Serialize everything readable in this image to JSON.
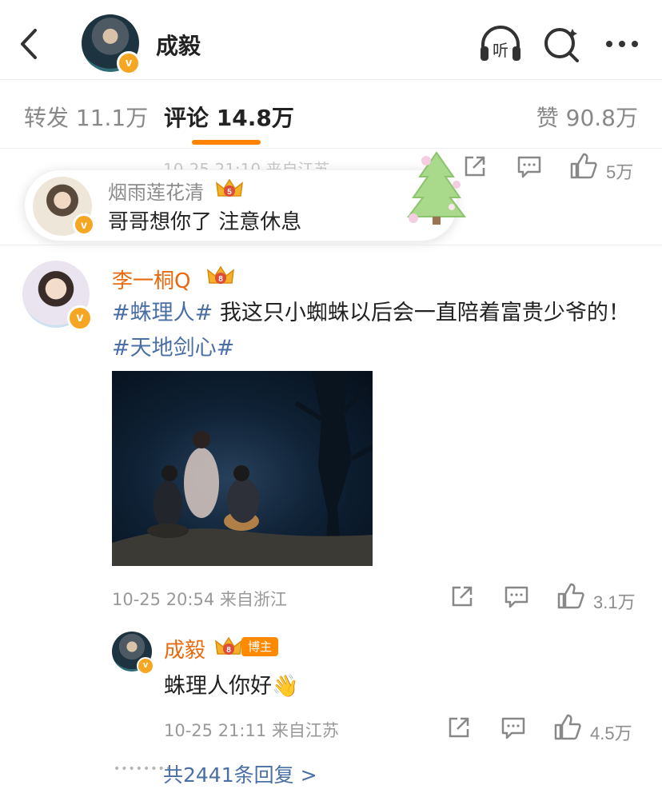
{
  "header": {
    "title": "成毅",
    "icons": [
      "back-icon",
      "listen-icon",
      "search-icon",
      "more-icon"
    ],
    "listen_label": "听",
    "verified_mark": "v"
  },
  "tabs": [
    {
      "label": "转发 11.1万"
    },
    {
      "label": "评论 14.8万",
      "active": true
    },
    {
      "label": "赞 90.8万"
    }
  ],
  "ghost_row": {
    "date": "10-25 21:10 来自江苏",
    "like_count": "5万"
  },
  "bubble": {
    "name": "烟雨莲花清",
    "text": "哥哥想你了 注意休息",
    "crown_level": "5"
  },
  "comment": {
    "user": "李一桐Q",
    "crown_level": "8",
    "tag1": "#蛛理人#",
    "text": " 我这只小蜘蛛以后会一直陪着富贵少爷的！",
    "tag2": "#天地剑心#",
    "date": "10-25 20:54",
    "location": "来自浙江",
    "like_count": "3.1万"
  },
  "reply": {
    "user": "成毅",
    "badge": "博主",
    "crown_level": "8",
    "text": "蛛理人你好",
    "emoji": "👋",
    "date": "10-25 21:11",
    "location": "来自江苏",
    "like_count": "4.5万"
  },
  "more_replies": "共2441条回复 >",
  "colors": {
    "accent": "#ff8200",
    "username": "#e86a10",
    "link": "#4a6fa5",
    "verified": "#f5a623"
  }
}
